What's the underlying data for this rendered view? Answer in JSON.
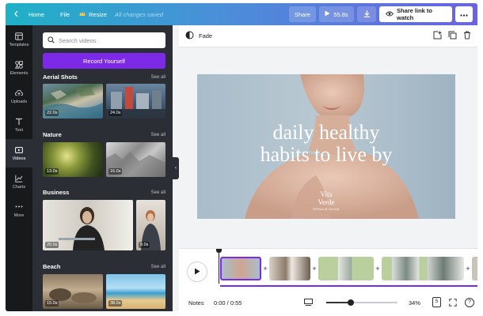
{
  "topbar": {
    "home_label": "Home",
    "file_label": "File",
    "resize_label": "Resize",
    "status": "All changes saved",
    "share_label": "Share",
    "play_duration": "55.8s",
    "share_link_label": "Share link to watch",
    "gradient_start": "#1fb1c7",
    "gradient_end": "#6b63e0"
  },
  "rail": {
    "items": [
      {
        "label": "Templates",
        "icon": "template-icon"
      },
      {
        "label": "Elements",
        "icon": "elements-icon"
      },
      {
        "label": "Uploads",
        "icon": "upload-icon"
      },
      {
        "label": "Text",
        "icon": "text-icon"
      },
      {
        "label": "Videos",
        "icon": "video-icon",
        "active": true
      },
      {
        "label": "Charts",
        "icon": "chart-icon"
      },
      {
        "label": "More",
        "icon": "more-icon"
      }
    ]
  },
  "panel": {
    "search_placeholder": "Search videos",
    "record_label": "Record Yourself",
    "accent": "#7d2ae8",
    "see_all": "See all",
    "sections": [
      {
        "title": "Aerial Shots",
        "durations": [
          "22.0s",
          "24.0s"
        ]
      },
      {
        "title": "Nature",
        "durations": [
          "13.0s",
          "16.0s"
        ]
      },
      {
        "title": "Business",
        "durations": [
          "20.0s",
          "9.0s"
        ]
      },
      {
        "title": "Beach",
        "durations": [
          "15.0s",
          "38.0s"
        ]
      }
    ]
  },
  "editor": {
    "effect_label": "Fade",
    "slide_line1": "daily healthy",
    "slide_line2": "habits to live by",
    "brand_line1": "Vita",
    "brand_line2": "Verde",
    "brand_tagline": "Wellness & Lifestyle"
  },
  "footer": {
    "notes_label": "Notes",
    "time": "0:00 / 0:55",
    "zoom": "34%",
    "zoom_fraction": 0.34,
    "page_count": "5"
  }
}
